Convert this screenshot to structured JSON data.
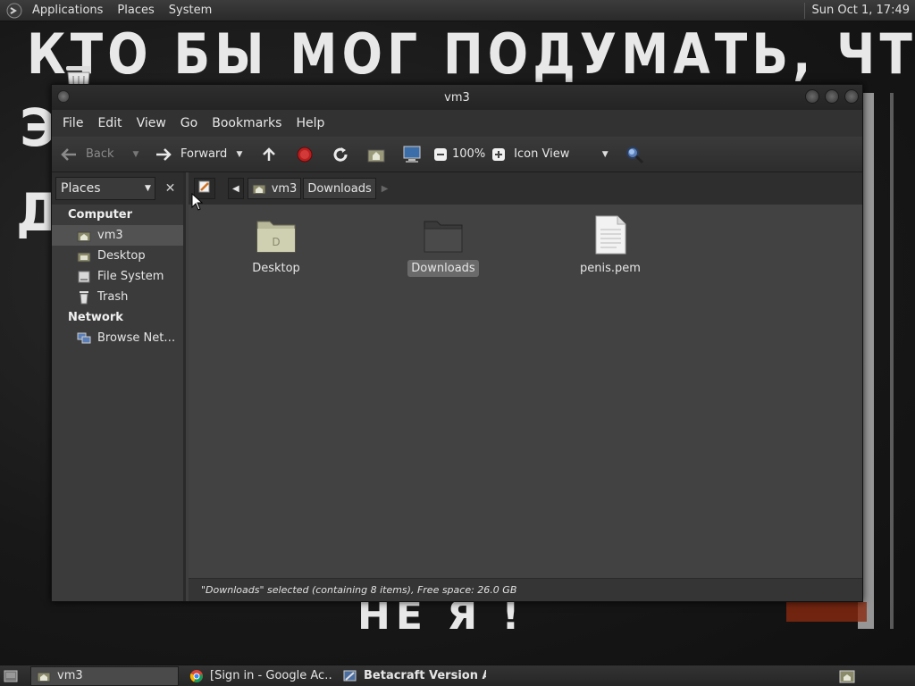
{
  "top_panel": {
    "menus": [
      "Applications",
      "Places",
      "System"
    ],
    "clock": "Sun Oct  1, 17:49"
  },
  "wallpaper": {
    "line1": "КТО БЫ МОГ ПОДУМАТЬ, ЧТО Я -",
    "line2": "Э",
    "line3": "Д",
    "line4": "НЕ Я !"
  },
  "window": {
    "title": "vm3",
    "menubar": [
      "File",
      "Edit",
      "View",
      "Go",
      "Bookmarks",
      "Help"
    ],
    "toolbar": {
      "back_label": "Back",
      "forward_label": "Forward",
      "zoom_level": "100%",
      "view_mode": "Icon View"
    },
    "sidepane": {
      "selector_label": "Places",
      "sections": [
        {
          "title": "Computer",
          "items": [
            {
              "label": "vm3",
              "icon": "home-icon"
            },
            {
              "label": "Desktop",
              "icon": "desktop-icon"
            },
            {
              "label": "File System",
              "icon": "drive-icon"
            },
            {
              "label": "Trash",
              "icon": "trash-icon"
            }
          ]
        },
        {
          "title": "Network",
          "items": [
            {
              "label": "Browse Net…",
              "icon": "network-icon"
            }
          ]
        }
      ]
    },
    "pathbar": {
      "crumbs": [
        "vm3",
        "Downloads"
      ]
    },
    "files": [
      {
        "name": "Desktop",
        "type": "folder"
      },
      {
        "name": "Downloads",
        "type": "folder"
      },
      {
        "name": "penis.pem",
        "type": "text-file"
      }
    ],
    "status": "\"Downloads\" selected (containing 8 items), Free space: 26.0 GB"
  },
  "taskbar": {
    "tasks": [
      "vm3",
      "[Sign in - Google Ac…",
      "Betacraft Version A…"
    ]
  }
}
